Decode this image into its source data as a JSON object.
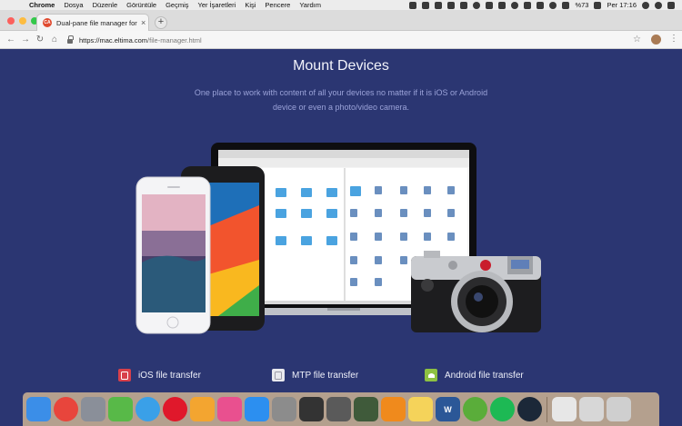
{
  "menubar": {
    "apple": "",
    "app": "Chrome",
    "items": [
      "Dosya",
      "Düzenle",
      "Görüntüle",
      "Geçmiş",
      "Yer İşaretleri",
      "Kişi",
      "Pencere",
      "Yardım"
    ],
    "battery": "%73",
    "clock": "Per 17:16"
  },
  "browser": {
    "tab_title": "Dual-pane file manager for Mac",
    "tab_favicon": "CA",
    "close_glyph": "×",
    "newtab_glyph": "+",
    "back_glyph": "←",
    "forward_glyph": "→",
    "reload_glyph": "↻",
    "home_glyph": "⌂",
    "star_glyph": "☆",
    "menu_glyph": "⋮",
    "url_host": "https://mac.eltima.com",
    "url_path": "/file-manager.html"
  },
  "page": {
    "heading": "Mount Devices",
    "subtext": "One place to work with content of all your devices no matter if it is iOS or Android device or even a photo/video camera.",
    "features": [
      {
        "label": "iOS file transfer",
        "icon": "ios-icon"
      },
      {
        "label": "MTP file transfer",
        "icon": "mtp-icon"
      },
      {
        "label": "Android file transfer",
        "icon": "android-icon"
      }
    ]
  },
  "colors": {
    "page_bg": "#2b3672",
    "heading": "#f2f3fa",
    "subtext": "#9aa2d8"
  },
  "dock": {
    "apps": [
      {
        "name": "finder-icon",
        "color": "#3b8ee8",
        "glyph": ""
      },
      {
        "name": "chrome-icon",
        "color": "#e8453c",
        "glyph": ""
      },
      {
        "name": "launchpad-icon",
        "color": "#8a8f99",
        "glyph": ""
      },
      {
        "name": "camtasia-icon",
        "color": "#58b948",
        "glyph": ""
      },
      {
        "name": "safari-icon",
        "color": "#3aa0e8",
        "glyph": ""
      },
      {
        "name": "opera-icon",
        "color": "#e0182b",
        "glyph": ""
      },
      {
        "name": "photos-icon",
        "color": "#f3a530",
        "glyph": ""
      },
      {
        "name": "itunes-icon",
        "color": "#e9508f",
        "glyph": ""
      },
      {
        "name": "app-store-icon",
        "color": "#2c8ff0",
        "glyph": ""
      },
      {
        "name": "system-preferences-icon",
        "color": "#8c8c8c",
        "glyph": ""
      },
      {
        "name": "activity-monitor-icon",
        "color": "#333333",
        "glyph": ""
      },
      {
        "name": "disk-utility-icon",
        "color": "#5a5a5a",
        "glyph": ""
      },
      {
        "name": "commander-one-icon",
        "color": "#3f5a3a",
        "glyph": ""
      },
      {
        "name": "vlc-icon",
        "color": "#f08a1c",
        "glyph": ""
      },
      {
        "name": "notes-icon",
        "color": "#f5d35a",
        "glyph": ""
      },
      {
        "name": "word-icon",
        "color": "#2b5797",
        "glyph": "W"
      },
      {
        "name": "utorrent-icon",
        "color": "#5aad3a",
        "glyph": ""
      },
      {
        "name": "spotify-icon",
        "color": "#1db954",
        "glyph": ""
      },
      {
        "name": "steam-icon",
        "color": "#1b2838",
        "glyph": ""
      },
      {
        "name": "file-icon",
        "color": "#e7e7e7",
        "glyph": ""
      },
      {
        "name": "preview-icon",
        "color": "#d7d7d7",
        "glyph": ""
      },
      {
        "name": "trash-icon",
        "color": "#cfcfcf",
        "glyph": ""
      }
    ]
  }
}
